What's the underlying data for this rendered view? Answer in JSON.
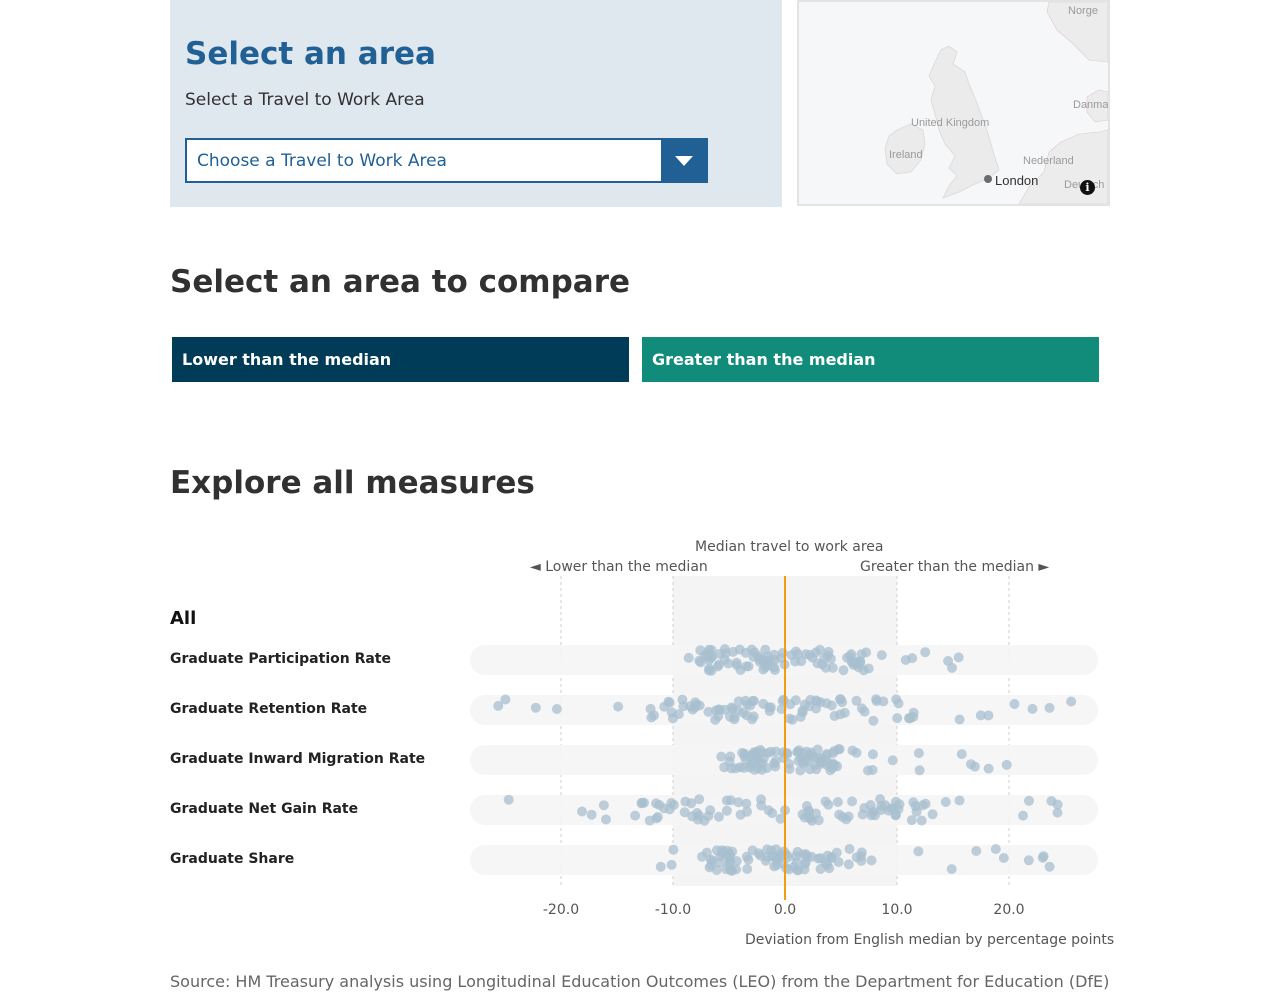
{
  "area": {
    "title": "Select an area",
    "subtitle": "Select a Travel to Work Area",
    "dropdown_placeholder": "Choose a Travel to Work Area",
    "dropdown_icon": "chevron-down-icon"
  },
  "map": {
    "labels": {
      "norge": "Norge",
      "danmark": "Danma",
      "united_kingdom": "United Kingdom",
      "ireland": "Ireland",
      "nederland": "Nederland",
      "deutsch": "Deutsch",
      "london": "London"
    },
    "info_icon": "info-icon",
    "info_glyph": "i"
  },
  "compare": {
    "title": "Select an area to compare",
    "lower_label": "Lower than the median",
    "greater_label": "Greater than the median",
    "lower_color": "#003c57",
    "greater_color": "#118c7b"
  },
  "explore": {
    "title": "Explore all measures"
  },
  "chart_data": {
    "type": "scatter",
    "median_label": "Median travel to work area",
    "lower_note": "◄ Lower than the median",
    "greater_note": "Greater than the median ►",
    "group": "All",
    "xlabel": "Deviation from English median by percentage points",
    "xlim": [
      -27,
      29
    ],
    "xticks": [
      -20,
      -10,
      0,
      10,
      20
    ],
    "xtick_labels": [
      "-20.0",
      "-10.0",
      "0.0",
      "10.0",
      "20.0"
    ],
    "shaded_band": [
      -10,
      10
    ],
    "median_value": 0,
    "median_color": "#f39c12",
    "point_color": "#a8bfcf",
    "series": [
      {
        "name": "Graduate Participation Rate",
        "spread": [
          -11.6,
          17.0
        ],
        "dense": [
          -8,
          8
        ]
      },
      {
        "name": "Graduate Retention Rate",
        "spread": [
          -25.7,
          26.0
        ],
        "dense": [
          -12,
          12
        ]
      },
      {
        "name": "Graduate Inward Migration Rate",
        "spread": [
          -6.4,
          22.5
        ],
        "dense": [
          -5,
          5
        ]
      },
      {
        "name": "Graduate Net Gain Rate",
        "spread": [
          -26.3,
          26.0
        ],
        "dense": [
          -13,
          13
        ]
      },
      {
        "name": "Graduate Share",
        "spread": [
          -12.2,
          24.1
        ],
        "dense": [
          -7,
          7
        ]
      }
    ]
  },
  "source": "Source: HM Treasury analysis using Longitudinal Education Outcomes (LEO) from the Department for Education (DfE)"
}
